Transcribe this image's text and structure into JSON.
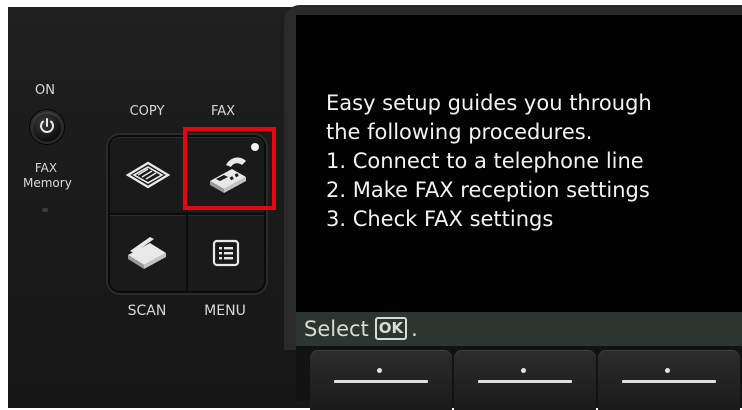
{
  "panel": {
    "on_label": "ON",
    "fax_memory_label_1": "FAX",
    "fax_memory_label_2": "Memory",
    "copy_label": "COPY",
    "fax_label": "FAX",
    "scan_label": "SCAN",
    "menu_label": "MENU"
  },
  "icons": {
    "power": "power-icon",
    "copy": "copy-icon",
    "fax": "fax-icon",
    "scan": "scan-icon",
    "menu": "menu-icon"
  },
  "screen": {
    "lines": [
      "Easy setup guides you through",
      "the following procedures.",
      "1. Connect to a telephone line",
      "2. Make FAX reception settings",
      "3. Check FAX settings"
    ],
    "status_prefix": "Select",
    "status_key": "OK",
    "status_suffix": "."
  },
  "colors": {
    "highlight": "#e30613",
    "screen_bg": "#020202",
    "status_bg": "#2b3630"
  }
}
